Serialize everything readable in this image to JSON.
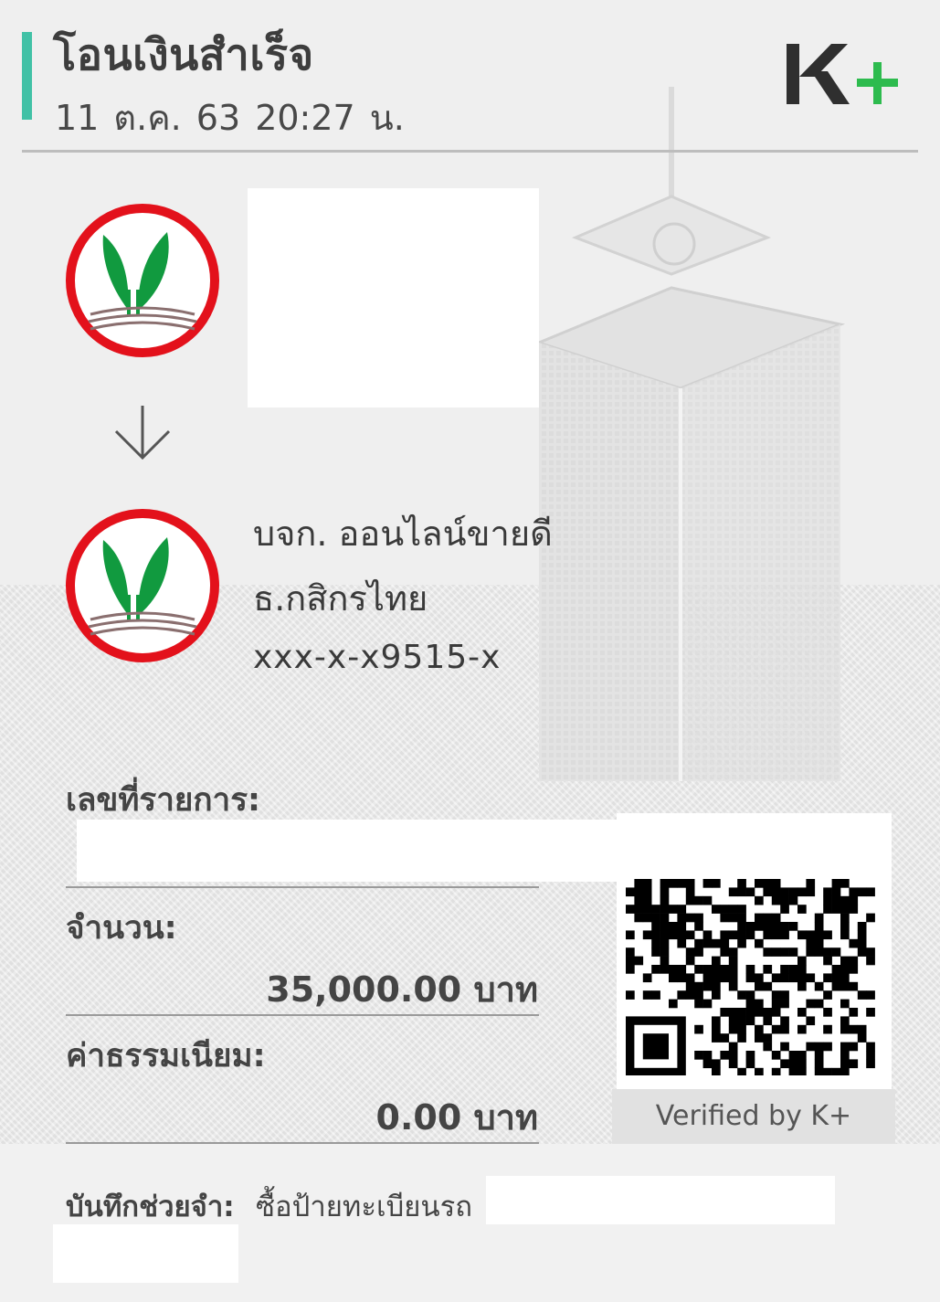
{
  "header": {
    "title": "โอนเงินสำเร็จ",
    "datetime": "11 ต.ค. 63  20:27 น.",
    "brand_logo_text": "K+",
    "accent_color": "#41c1a6",
    "brand_plus_color": "#2dbb4e"
  },
  "sender": {
    "bank_logo_icon": "kasikorn-bank-logo"
  },
  "transfer_arrow_icon": "arrow-down-icon",
  "receiver": {
    "bank_logo_icon": "kasikorn-bank-logo",
    "name": "บจก. ออนไลน์ขายดี",
    "bank": "ธ.กสิกรไทย",
    "account": "xxx-x-x9515-x"
  },
  "transaction": {
    "ref_label": "เลขที่รายการ:",
    "amount_label": "จำนวน:",
    "amount_value": "35,000.00 บาท",
    "fee_label": "ค่าธรรมเนียม:",
    "fee_value": "0.00 บาท"
  },
  "qr": {
    "caption": "Verified by K+"
  },
  "memo": {
    "label": "บันทึกช่วยจำ:",
    "value": "ซื้อป้ายทะเบียนรถ"
  },
  "colors": {
    "kbank_green": "#119a3f",
    "kbank_red": "#e3111b"
  }
}
